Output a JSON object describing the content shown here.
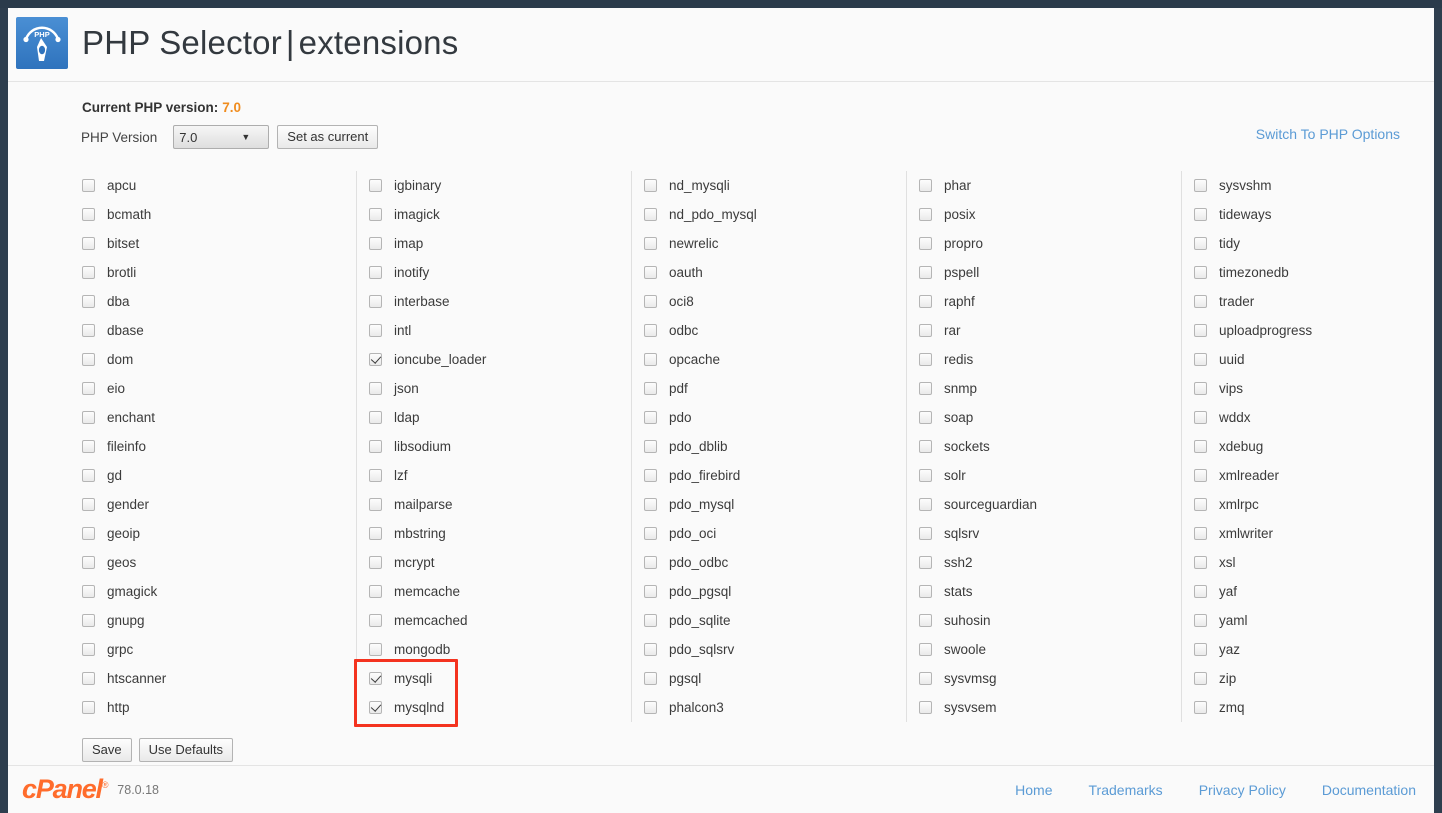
{
  "header": {
    "title_main": "PHP Selector",
    "title_sep": "|",
    "title_sub": "extensions",
    "logo_text": "PHP"
  },
  "version": {
    "current_label": "Current PHP version:",
    "current_value": "7.0",
    "select_label": "PHP Version",
    "selected": "7.0",
    "options": [
      "7.0"
    ],
    "set_as_current_label": "Set as current",
    "switch_link_label": "Switch To PHP Options"
  },
  "actions": {
    "save_label": "Save",
    "use_defaults_label": "Use Defaults"
  },
  "footer": {
    "brand": "cPanel",
    "trademark": "®",
    "version": "78.0.18",
    "links": [
      "Home",
      "Trademarks",
      "Privacy Policy",
      "Documentation"
    ]
  },
  "annotation": {
    "color": "#f4331f",
    "highlights": [
      "mysqli",
      "mysqlnd"
    ]
  },
  "colors": {
    "accent_orange": "#f08c1e",
    "link_blue": "#5b9bd5",
    "brand_orange": "#ff6c2c",
    "annotation_red": "#f4331f"
  },
  "extensions": {
    "columns": [
      {
        "items": [
          {
            "name": "apcu",
            "checked": false
          },
          {
            "name": "bcmath",
            "checked": false
          },
          {
            "name": "bitset",
            "checked": false
          },
          {
            "name": "brotli",
            "checked": false
          },
          {
            "name": "dba",
            "checked": false
          },
          {
            "name": "dbase",
            "checked": false
          },
          {
            "name": "dom",
            "checked": false
          },
          {
            "name": "eio",
            "checked": false
          },
          {
            "name": "enchant",
            "checked": false
          },
          {
            "name": "fileinfo",
            "checked": false
          },
          {
            "name": "gd",
            "checked": false
          },
          {
            "name": "gender",
            "checked": false
          },
          {
            "name": "geoip",
            "checked": false
          },
          {
            "name": "geos",
            "checked": false
          },
          {
            "name": "gmagick",
            "checked": false
          },
          {
            "name": "gnupg",
            "checked": false
          },
          {
            "name": "grpc",
            "checked": false
          },
          {
            "name": "htscanner",
            "checked": false
          },
          {
            "name": "http",
            "checked": false
          }
        ]
      },
      {
        "items": [
          {
            "name": "igbinary",
            "checked": false
          },
          {
            "name": "imagick",
            "checked": false
          },
          {
            "name": "imap",
            "checked": false
          },
          {
            "name": "inotify",
            "checked": false
          },
          {
            "name": "interbase",
            "checked": false
          },
          {
            "name": "intl",
            "checked": false
          },
          {
            "name": "ioncube_loader",
            "checked": true
          },
          {
            "name": "json",
            "checked": false
          },
          {
            "name": "ldap",
            "checked": false
          },
          {
            "name": "libsodium",
            "checked": false
          },
          {
            "name": "lzf",
            "checked": false
          },
          {
            "name": "mailparse",
            "checked": false
          },
          {
            "name": "mbstring",
            "checked": false
          },
          {
            "name": "mcrypt",
            "checked": false
          },
          {
            "name": "memcache",
            "checked": false
          },
          {
            "name": "memcached",
            "checked": false
          },
          {
            "name": "mongodb",
            "checked": false
          },
          {
            "name": "mysqli",
            "checked": true,
            "highlighted": true
          },
          {
            "name": "mysqlnd",
            "checked": true,
            "highlighted": true
          }
        ]
      },
      {
        "items": [
          {
            "name": "nd_mysqli",
            "checked": false
          },
          {
            "name": "nd_pdo_mysql",
            "checked": false
          },
          {
            "name": "newrelic",
            "checked": false
          },
          {
            "name": "oauth",
            "checked": false
          },
          {
            "name": "oci8",
            "checked": false
          },
          {
            "name": "odbc",
            "checked": false
          },
          {
            "name": "opcache",
            "checked": false
          },
          {
            "name": "pdf",
            "checked": false
          },
          {
            "name": "pdo",
            "checked": false
          },
          {
            "name": "pdo_dblib",
            "checked": false
          },
          {
            "name": "pdo_firebird",
            "checked": false
          },
          {
            "name": "pdo_mysql",
            "checked": false
          },
          {
            "name": "pdo_oci",
            "checked": false
          },
          {
            "name": "pdo_odbc",
            "checked": false
          },
          {
            "name": "pdo_pgsql",
            "checked": false
          },
          {
            "name": "pdo_sqlite",
            "checked": false
          },
          {
            "name": "pdo_sqlsrv",
            "checked": false
          },
          {
            "name": "pgsql",
            "checked": false
          },
          {
            "name": "phalcon3",
            "checked": false
          }
        ]
      },
      {
        "items": [
          {
            "name": "phar",
            "checked": false
          },
          {
            "name": "posix",
            "checked": false
          },
          {
            "name": "propro",
            "checked": false
          },
          {
            "name": "pspell",
            "checked": false
          },
          {
            "name": "raphf",
            "checked": false
          },
          {
            "name": "rar",
            "checked": false
          },
          {
            "name": "redis",
            "checked": false
          },
          {
            "name": "snmp",
            "checked": false
          },
          {
            "name": "soap",
            "checked": false
          },
          {
            "name": "sockets",
            "checked": false
          },
          {
            "name": "solr",
            "checked": false
          },
          {
            "name": "sourceguardian",
            "checked": false
          },
          {
            "name": "sqlsrv",
            "checked": false
          },
          {
            "name": "ssh2",
            "checked": false
          },
          {
            "name": "stats",
            "checked": false
          },
          {
            "name": "suhosin",
            "checked": false
          },
          {
            "name": "swoole",
            "checked": false
          },
          {
            "name": "sysvmsg",
            "checked": false
          },
          {
            "name": "sysvsem",
            "checked": false
          }
        ]
      },
      {
        "items": [
          {
            "name": "sysvshm",
            "checked": false
          },
          {
            "name": "tideways",
            "checked": false
          },
          {
            "name": "tidy",
            "checked": false
          },
          {
            "name": "timezonedb",
            "checked": false
          },
          {
            "name": "trader",
            "checked": false
          },
          {
            "name": "uploadprogress",
            "checked": false
          },
          {
            "name": "uuid",
            "checked": false
          },
          {
            "name": "vips",
            "checked": false
          },
          {
            "name": "wddx",
            "checked": false
          },
          {
            "name": "xdebug",
            "checked": false
          },
          {
            "name": "xmlreader",
            "checked": false
          },
          {
            "name": "xmlrpc",
            "checked": false
          },
          {
            "name": "xmlwriter",
            "checked": false
          },
          {
            "name": "xsl",
            "checked": false
          },
          {
            "name": "yaf",
            "checked": false
          },
          {
            "name": "yaml",
            "checked": false
          },
          {
            "name": "yaz",
            "checked": false
          },
          {
            "name": "zip",
            "checked": false
          },
          {
            "name": "zmq",
            "checked": false
          }
        ]
      }
    ]
  }
}
